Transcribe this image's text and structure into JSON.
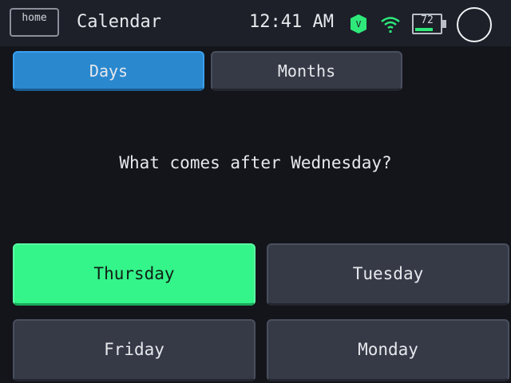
{
  "statusbar": {
    "home_label": "home",
    "app_title": "Calendar",
    "clock": "12:41 AM",
    "badge_letter": "V",
    "battery_level": "72",
    "battery_fraction": 0.72,
    "accent_color": "#2ee97a"
  },
  "tabs": [
    {
      "label": "Days",
      "active": true
    },
    {
      "label": "Months",
      "active": false
    }
  ],
  "question": "What comes after Wednesday?",
  "answers": [
    {
      "label": "Thursday",
      "highlighted": true
    },
    {
      "label": "Tuesday",
      "highlighted": false
    },
    {
      "label": "Friday",
      "highlighted": false
    },
    {
      "label": "Monday",
      "highlighted": false
    }
  ],
  "colors": {
    "background": "#13151b",
    "statusbar": "#1d2029",
    "tab_active": "#2a88cf",
    "button": "#363a47",
    "correct": "#34f58a"
  },
  "icons": [
    "wifi-icon",
    "battery-icon",
    "circle-icon",
    "v-badge-icon"
  ]
}
